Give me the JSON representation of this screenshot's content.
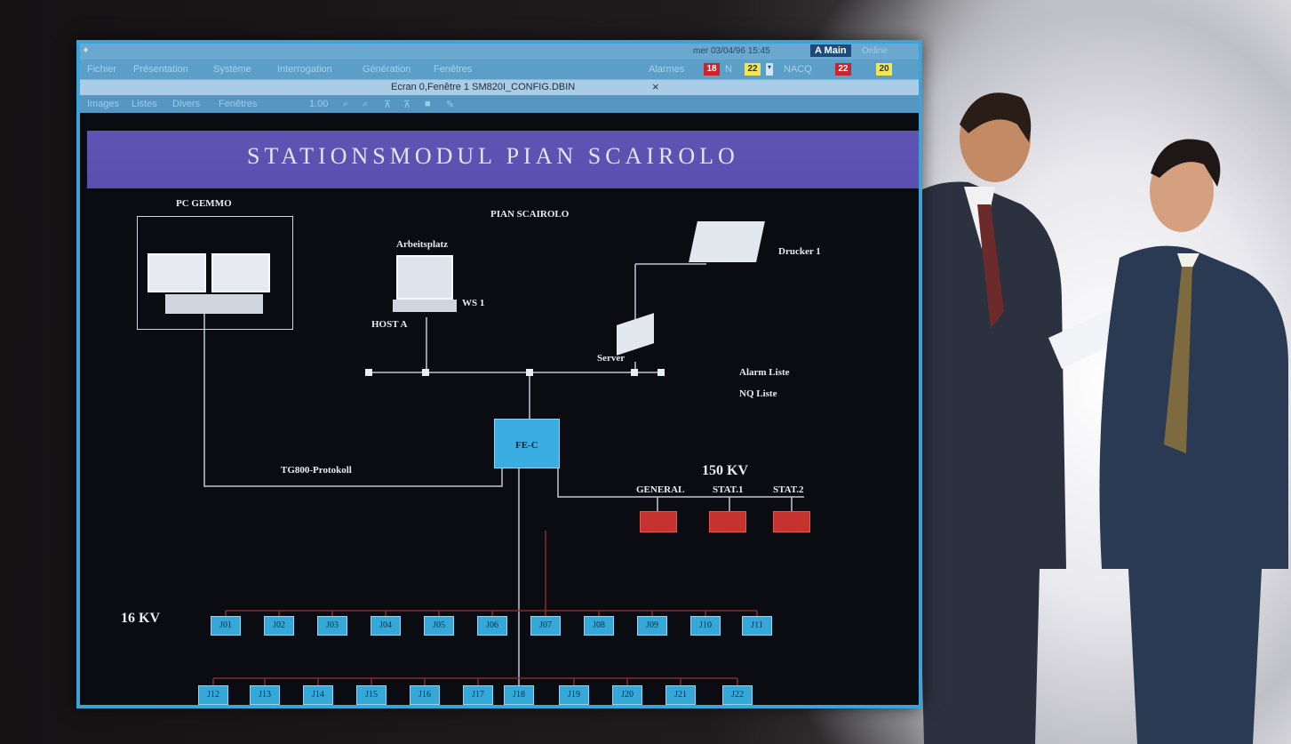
{
  "titlebar": {
    "datetime": "mer 03/04/96 15:45",
    "mode": "A Main",
    "status": "Online"
  },
  "menu": {
    "items": [
      "Fichier",
      "Présentation",
      "Système",
      "Interrogation",
      "Génération",
      "Fenêtres"
    ],
    "alarms_label": "Alarmes",
    "alarms_red": "18",
    "alarms_n": "N",
    "alarms_yellow": "22",
    "naco_label": "NACQ",
    "naco_red": "22",
    "naco_yellow": "20"
  },
  "document": {
    "title": "Ecran 0,Fenêtre 1   SM820I_CONFIG.DBIN",
    "close": "×"
  },
  "toolbar": {
    "items": [
      "Images",
      "Listes",
      "Divers",
      "Fenêtres"
    ],
    "zoom": "1.00"
  },
  "diagram": {
    "title": "STATIONSMODUL   PIAN SCAIROLO",
    "pc_label": "PC GEMMO",
    "site_label": "PIAN SCAIROLO",
    "workstation_label": "Arbeitsplatz",
    "ws_label": "WS 1",
    "host_label": "HOST A",
    "printer_label": "Drucker 1",
    "server_label": "Server",
    "alarm_list": "Alarm Liste",
    "nq_list": "NQ Liste",
    "fec_label": "FE-C",
    "protocol_label": "TG800-Protokoll",
    "kv150": "150 KV",
    "kv16": "16 KV",
    "breakers": [
      "GENERAL",
      "STAT.1",
      "STAT.2"
    ],
    "feeders_top": [
      "J01",
      "J02",
      "J03",
      "J04",
      "J05",
      "J06",
      "J07",
      "J08",
      "J09",
      "J10",
      "J11"
    ],
    "feeders_bottom": [
      "J12",
      "J13",
      "J14",
      "J15",
      "J16",
      "J17",
      "J18",
      "J19",
      "J20",
      "J21",
      "J22"
    ]
  },
  "colors": {
    "frame": "#3aa4d8",
    "banner": "#5a4fae",
    "feeder": "#36a8d8",
    "breaker": "#c6332f",
    "alarm_red": "#c8262c",
    "alarm_yellow": "#f1e65a"
  }
}
